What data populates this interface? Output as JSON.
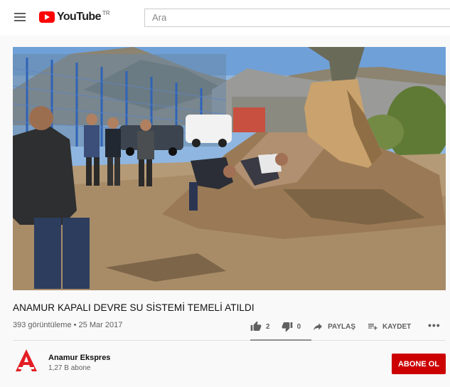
{
  "header": {
    "logo_text": "YouTube",
    "country_code": "TR",
    "search_placeholder": "Ara"
  },
  "video": {
    "title": "ANAMUR KAPALI DEVRE SU SİSTEMİ TEMELİ ATILDI",
    "views": "393 görüntüleme",
    "separator": "•",
    "date": "25 Mar 2017",
    "likes": "2",
    "dislikes": "0",
    "share_label": "PAYLAŞ",
    "save_label": "KAYDET"
  },
  "channel": {
    "name": "Anamur Ekspres",
    "subscribers": "1,27 B abone",
    "subscribe_label": "ABONE OL"
  },
  "colors": {
    "brand_red": "#ff0000",
    "subscribe_red": "#cc0000"
  }
}
